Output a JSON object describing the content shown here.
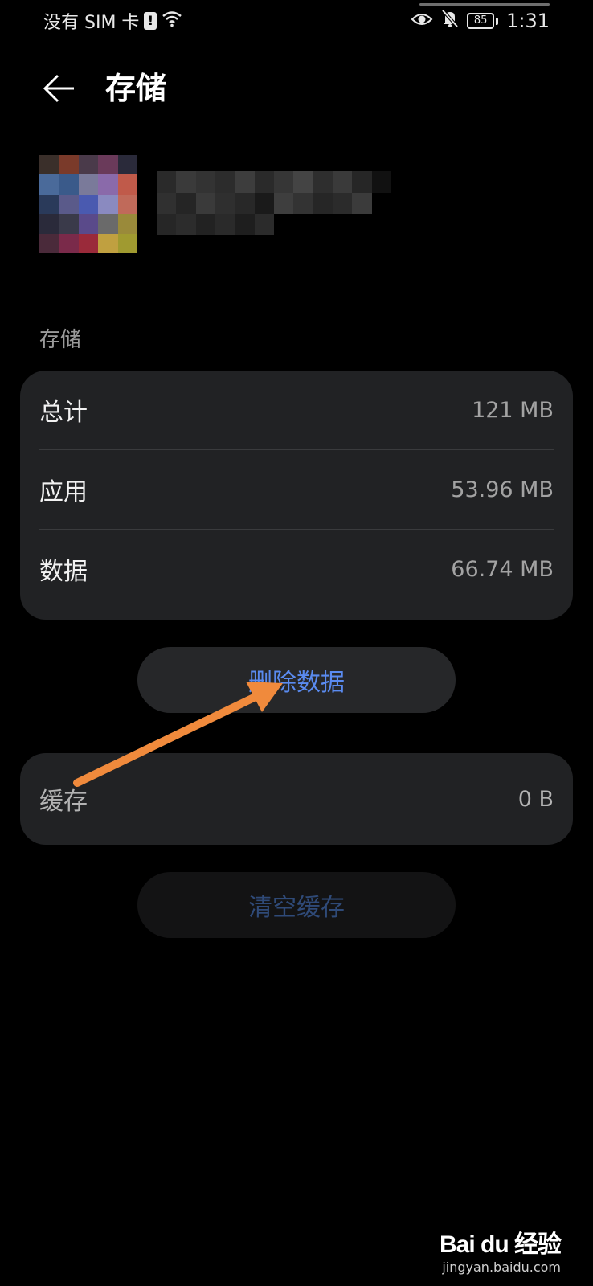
{
  "status_bar": {
    "carrier": "没有 SIM 卡",
    "sim_alert_icon": "!",
    "battery_level": "85",
    "time": "1:31",
    "icons": [
      "sim-alert-icon",
      "wifi-icon",
      "eye-icon",
      "bell-off-icon",
      "battery-icon"
    ]
  },
  "header": {
    "title": "存储",
    "back_icon": "back-arrow-icon"
  },
  "section": {
    "label": "存储"
  },
  "storage": {
    "rows": [
      {
        "label": "总计",
        "value": "121 MB"
      },
      {
        "label": "应用",
        "value": "53.96 MB"
      },
      {
        "label": "数据",
        "value": "66.74 MB"
      }
    ]
  },
  "buttons": {
    "delete_data": "删除数据",
    "clear_cache": "清空缓存"
  },
  "cache": {
    "label": "缓存",
    "value": "0 B"
  },
  "watermark": {
    "logo": "Bai du 经验",
    "url": "jingyan.baidu.com"
  },
  "colors": {
    "background": "#000000",
    "card": "#212224",
    "accent_blue": "#5a8bf0",
    "annotation_arrow": "#f08a3c"
  }
}
